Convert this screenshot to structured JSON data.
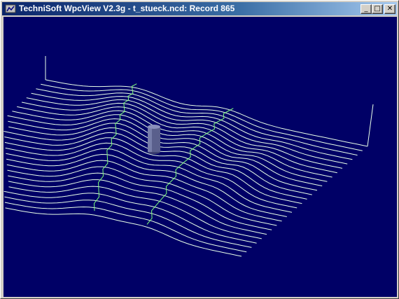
{
  "window": {
    "title": "TechniSoft WpcView V2.3g - t_stueck.ncd: Record 865",
    "controls": {
      "minimize_glyph": "_",
      "maximize_glyph": "□",
      "close_glyph": "✕"
    },
    "icon": "app-icon"
  },
  "viewport": {
    "background_color": "#000066",
    "toolpath_color": "#e8ffe8",
    "trace_color": "#7fff7f",
    "tool_color": "#6a6f9a"
  }
}
